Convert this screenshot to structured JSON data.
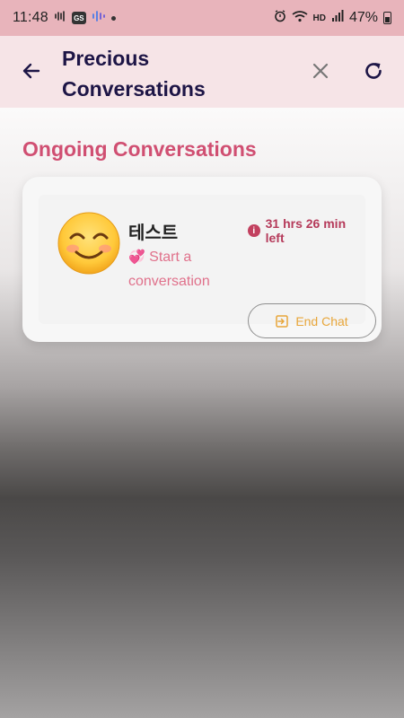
{
  "status_bar": {
    "time": "11:48",
    "gs_badge": "GS",
    "hd_label": "HD",
    "battery": "47%",
    "icons": [
      "voice-wave-icon",
      "gs-app-icon",
      "assistant-icon",
      "notification-dot",
      "alarm-icon",
      "wifi-icon",
      "hd-voice-icon",
      "signal-icon",
      "battery-icon"
    ]
  },
  "app_bar": {
    "title": "Precious Conversations",
    "back_icon": "arrow-left-icon",
    "close_icon": "close-icon",
    "refresh_icon": "refresh-icon"
  },
  "section": {
    "title": "Ongoing Conversations"
  },
  "conversations": [
    {
      "avatar": "smiling-face-emoji",
      "avatar_glyph": "😊",
      "name": "테스트",
      "time_left": "31 hrs 26 min left",
      "message_prefix_icon": "💞",
      "message": "Start a conversation",
      "end_button_label": "End Chat"
    }
  ],
  "colors": {
    "status_bar_bg": "#e8b4bb",
    "app_bar_bg": "#f6e4e7",
    "title_color": "#1d1546",
    "section_title_color": "#d04f72",
    "timer_color": "#b53a5a",
    "message_color": "#e0718b",
    "end_button_text": "#e8a63a"
  }
}
